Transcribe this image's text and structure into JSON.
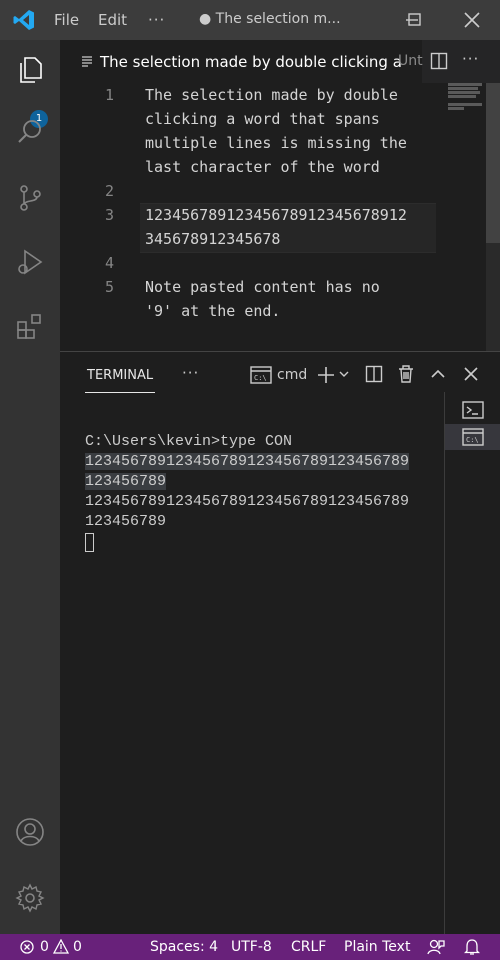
{
  "menu": {
    "file": "File",
    "edit": "Edit",
    "more": "···"
  },
  "window": {
    "title": "● The selection m..."
  },
  "activity": {
    "explorer_badge": "1"
  },
  "tab": {
    "label": "The selection made by double clicking a",
    "second_label": "Unt",
    "more": "···"
  },
  "editor": {
    "lines": [
      {
        "num": "1",
        "text": "The selection made by double"
      },
      {
        "num": "",
        "text": "clicking a word that spans"
      },
      {
        "num": "",
        "text": "multiple lines is missing the"
      },
      {
        "num": "",
        "text": "last character of the word"
      },
      {
        "num": "2",
        "text": ""
      },
      {
        "num": "3",
        "text": "12345678912345678912345678912"
      },
      {
        "num": "",
        "text": "345678912345678"
      },
      {
        "num": "4",
        "text": ""
      },
      {
        "num": "5",
        "text": "Note pasted content has no"
      },
      {
        "num": "",
        "text": "'9' at the end."
      }
    ]
  },
  "panel": {
    "tab_label": "TERMINAL",
    "more": "···",
    "shell_label": "cmd"
  },
  "terminal": {
    "lines": [
      "C:\\Users\\kevin>type CON",
      "123456789123456789123456789123456789",
      "123456789",
      "123456789123456789123456789123456789",
      "123456789"
    ]
  },
  "status": {
    "errors": "0",
    "warnings": "0",
    "spaces": "Spaces: 4",
    "encoding": "UTF-8",
    "eol": "CRLF",
    "language": "Plain Text"
  },
  "colors": {
    "statusbar": "#68217a",
    "badge": "#0e639c",
    "vscode_blue": "#23a9f2"
  }
}
